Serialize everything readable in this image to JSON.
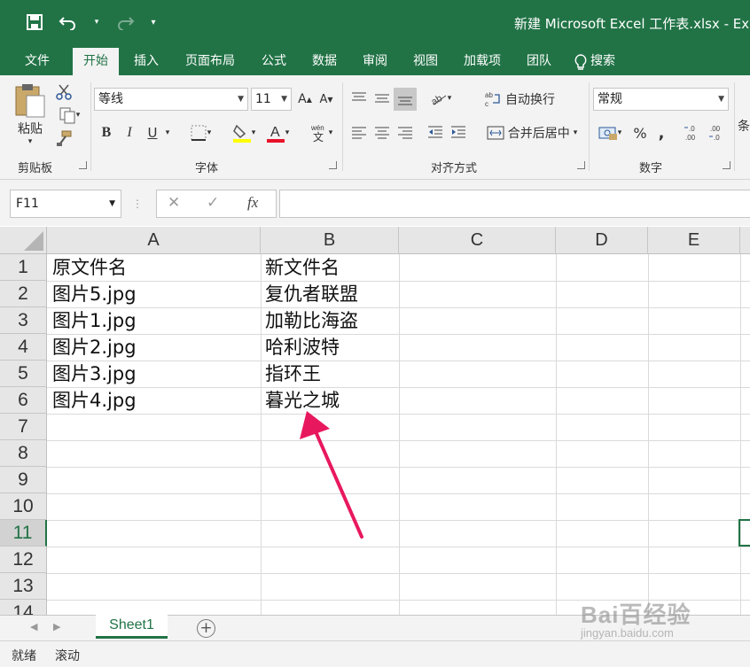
{
  "app": {
    "window_title": "新建 Microsoft Excel 工作表.xlsx - Ex"
  },
  "ribbon_tabs": [
    "文件",
    "开始",
    "插入",
    "页面布局",
    "公式",
    "数据",
    "审阅",
    "视图",
    "加载项",
    "团队",
    "搜索"
  ],
  "ribbon": {
    "clipboard": {
      "paste_label": "粘贴",
      "group_label": "剪贴板"
    },
    "font": {
      "font_name": "等线",
      "font_size": "11",
      "bold": "B",
      "italic": "I",
      "underline": "U",
      "group_label": "字体"
    },
    "alignment": {
      "wrap_text": "自动换行",
      "merge_center": "合并后居中",
      "group_label": "对齐方式"
    },
    "number": {
      "format": "常规",
      "group_label": "数字",
      "partial_next": "条"
    }
  },
  "formula_bar": {
    "name_box": "F11",
    "fx": "fx",
    "value": ""
  },
  "columns": [
    "A",
    "B",
    "C",
    "D",
    "E"
  ],
  "rows": [
    "1",
    "2",
    "3",
    "4",
    "5",
    "6",
    "7",
    "8",
    "9",
    "10",
    "11",
    "12",
    "13",
    "14"
  ],
  "cells": [
    {
      "a": "原文件名",
      "b": "新文件名"
    },
    {
      "a": "图片5.jpg",
      "b": "复仇者联盟"
    },
    {
      "a": "图片1.jpg",
      "b": "加勒比海盗"
    },
    {
      "a": "图片2.jpg",
      "b": "哈利波特"
    },
    {
      "a": "图片3.jpg",
      "b": "指环王"
    },
    {
      "a": "图片4.jpg",
      "b": "暮光之城"
    }
  ],
  "sheet_tabs": [
    "Sheet1"
  ],
  "status_bar": {
    "ready": "就绪",
    "scroll": "滚动"
  },
  "watermark": {
    "logo": "Bai百经验",
    "url": "jingyan.baidu.com"
  },
  "colors": {
    "accent": "#217346",
    "arrow": "#e8185f"
  }
}
